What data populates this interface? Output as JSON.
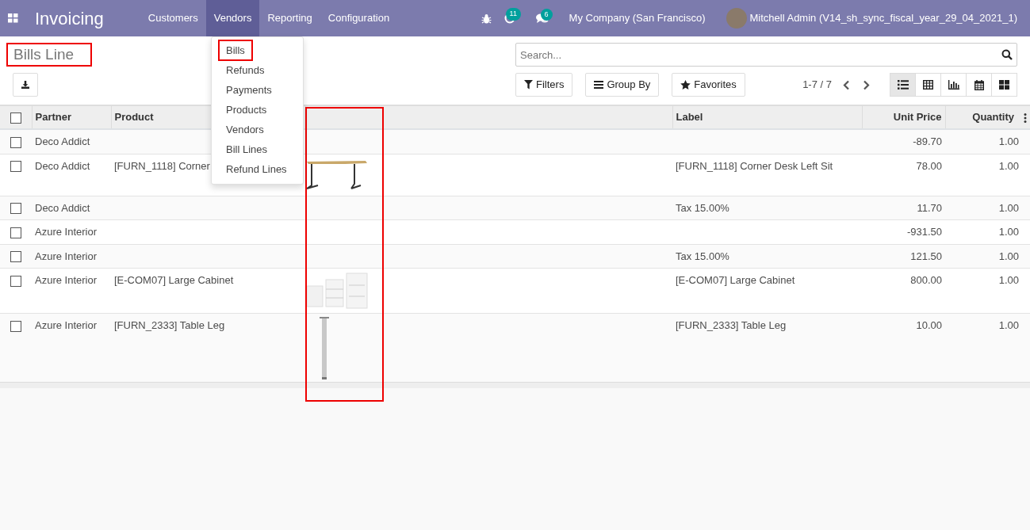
{
  "navbar": {
    "app_title": "Invoicing",
    "menus": [
      {
        "label": "Customers",
        "selected": false
      },
      {
        "label": "Vendors",
        "selected": true
      },
      {
        "label": "Reporting",
        "selected": false
      },
      {
        "label": "Configuration",
        "selected": false
      }
    ],
    "activity_count": "11",
    "message_count": "6",
    "company": "My Company (San Francisco)",
    "user": "Mitchell Admin (V14_sh_sync_fiscal_year_29_04_2021_1)"
  },
  "dropdown": {
    "items": [
      {
        "label": "Bills",
        "highlighted": true
      },
      {
        "label": "Refunds",
        "highlighted": false
      },
      {
        "label": "Payments",
        "highlighted": false
      },
      {
        "label": "Products",
        "highlighted": false
      },
      {
        "label": "Vendors",
        "highlighted": false
      },
      {
        "label": "Bill Lines",
        "highlighted": false
      },
      {
        "label": "Refund Lines",
        "highlighted": false
      }
    ]
  },
  "page_title": {
    "text": "Bills Line",
    "highlighted": true
  },
  "search": {
    "placeholder": "Search..."
  },
  "filter_buttons": [
    {
      "kind": "filter",
      "label": "Filters"
    },
    {
      "kind": "group",
      "label": "Group By"
    },
    {
      "kind": "star",
      "label": "Favorites"
    }
  ],
  "pager": "1-7 / 7",
  "views": [
    {
      "kind": "list",
      "selected": true
    },
    {
      "kind": "pivot",
      "selected": false
    },
    {
      "kind": "graph",
      "selected": false
    },
    {
      "kind": "calendar",
      "selected": false
    },
    {
      "kind": "kanban",
      "selected": false
    }
  ],
  "table": {
    "all_selected": false,
    "columns": [
      {
        "kind": "text",
        "label": "Partner"
      },
      {
        "kind": "text",
        "label": "Product"
      },
      {
        "kind": "image",
        "highlighted": true
      },
      {
        "kind": "text",
        "label": "Label"
      },
      {
        "kind": "number",
        "label": "Unit Price"
      },
      {
        "kind": "number",
        "label": "Quantity"
      }
    ],
    "rows": [
      {
        "selected": false,
        "partner": "Deco Addict",
        "unit_price": "-89.70",
        "quantity": "1.00"
      },
      {
        "selected": false,
        "partner": "Deco Addict",
        "product": "[FURN_1118] Corner",
        "kind": "desk",
        "label": "[FURN_1118] Corner Desk Left Sit",
        "unit_price": "78.00",
        "quantity": "1.00"
      },
      {
        "selected": false,
        "partner": "Deco Addict",
        "label": "Tax 15.00%",
        "unit_price": "11.70",
        "quantity": "1.00"
      },
      {
        "selected": false,
        "partner": "Azure Interior",
        "unit_price": "-931.50",
        "quantity": "1.00"
      },
      {
        "selected": false,
        "partner": "Azure Interior",
        "label": "Tax 15.00%",
        "unit_price": "121.50",
        "quantity": "1.00"
      },
      {
        "selected": false,
        "partner": "Azure Interior",
        "product": "[E-COM07] Large Cabinet",
        "kind": "cabinet",
        "label": "[E-COM07] Large Cabinet",
        "unit_price": "800.00",
        "quantity": "1.00"
      },
      {
        "selected": false,
        "partner": "Azure Interior",
        "product": "[FURN_2333] Table Leg",
        "kind": "leg",
        "label": "[FURN_2333] Table Leg",
        "unit_price": "10.00",
        "quantity": "1.00"
      }
    ]
  }
}
